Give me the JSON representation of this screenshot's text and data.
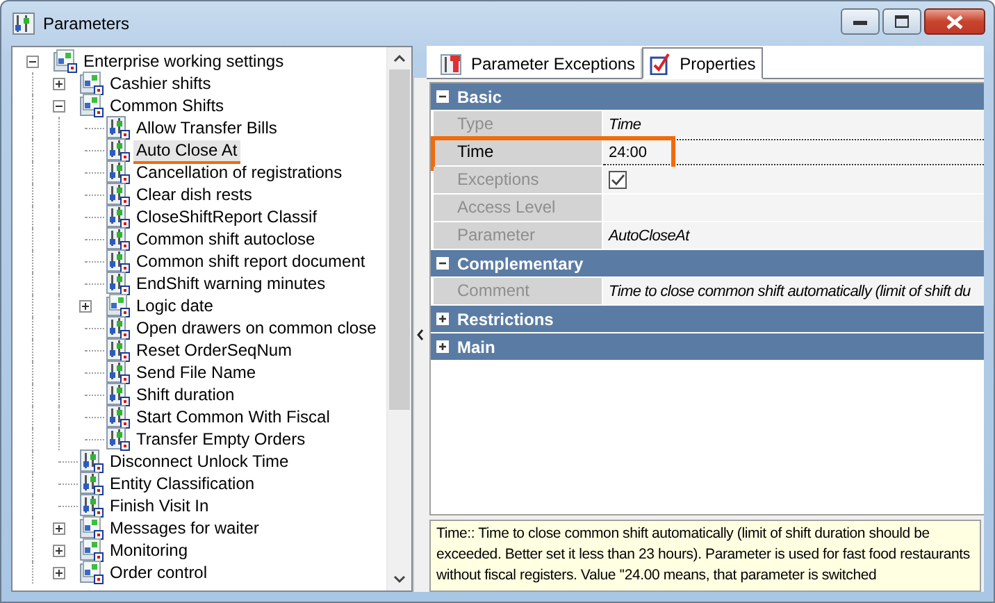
{
  "window": {
    "title": "Parameters"
  },
  "tree": [
    {
      "label": "Enterprise working settings",
      "kind": "group",
      "expanded": true,
      "selected": false,
      "annotated": false,
      "children": [
        {
          "label": "Cashier shifts",
          "kind": "group",
          "expanded": false,
          "selected": false,
          "annotated": false
        },
        {
          "label": "Common Shifts",
          "kind": "group",
          "expanded": true,
          "selected": false,
          "annotated": false,
          "children": [
            {
              "label": "Allow Transfer Bills",
              "kind": "param",
              "selected": false,
              "annotated": false
            },
            {
              "label": "Auto Close At",
              "kind": "param",
              "selected": true,
              "annotated": true
            },
            {
              "label": "Cancellation of registrations",
              "kind": "param",
              "selected": false,
              "annotated": false
            },
            {
              "label": "Clear dish rests",
              "kind": "param",
              "selected": false,
              "annotated": false
            },
            {
              "label": "CloseShiftReport Classif",
              "kind": "param",
              "selected": false,
              "annotated": false
            },
            {
              "label": "Common shift autoclose",
              "kind": "param",
              "selected": false,
              "annotated": false
            },
            {
              "label": "Common shift report document",
              "kind": "param",
              "selected": false,
              "annotated": false
            },
            {
              "label": "EndShift warning minutes",
              "kind": "param",
              "selected": false,
              "annotated": false
            },
            {
              "label": "Logic date",
              "kind": "group",
              "expanded": false,
              "selected": false,
              "annotated": false
            },
            {
              "label": "Open drawers on common close",
              "kind": "param",
              "selected": false,
              "annotated": false
            },
            {
              "label": "Reset OrderSeqNum",
              "kind": "param",
              "selected": false,
              "annotated": false
            },
            {
              "label": "Send File Name",
              "kind": "param",
              "selected": false,
              "annotated": false
            },
            {
              "label": "Shift duration",
              "kind": "param",
              "selected": false,
              "annotated": false
            },
            {
              "label": "Start Common With Fiscal",
              "kind": "param",
              "selected": false,
              "annotated": false
            },
            {
              "label": "Transfer Empty Orders",
              "kind": "param",
              "selected": false,
              "annotated": false
            }
          ]
        },
        {
          "label": "Disconnect Unlock Time",
          "kind": "param",
          "selected": false,
          "annotated": false
        },
        {
          "label": "Entity Classification",
          "kind": "param",
          "selected": false,
          "annotated": false
        },
        {
          "label": "Finish Visit In",
          "kind": "param",
          "selected": false,
          "annotated": false
        },
        {
          "label": "Messages for waiter",
          "kind": "group",
          "expanded": false,
          "selected": false,
          "annotated": false
        },
        {
          "label": "Monitoring",
          "kind": "group",
          "expanded": false,
          "selected": false,
          "annotated": false
        },
        {
          "label": "Order control",
          "kind": "group",
          "expanded": false,
          "selected": false,
          "annotated": false
        }
      ]
    }
  ],
  "tabs": [
    {
      "label": "Parameter Exceptions",
      "kind": "exceptions",
      "selected": false
    },
    {
      "label": "Properties",
      "kind": "properties",
      "selected": true
    }
  ],
  "grid": [
    {
      "name": "Basic",
      "expanded": true,
      "rows": [
        {
          "label": "Type",
          "kind": "text",
          "value": "Time",
          "readonly": true,
          "annotated": false
        },
        {
          "label": "Time",
          "kind": "text",
          "value": "24:00",
          "readonly": false,
          "annotated": true
        },
        {
          "label": "Exceptions",
          "kind": "checkbox",
          "checked": true,
          "readonly": true,
          "annotated": false
        },
        {
          "label": "Access Level",
          "kind": "text",
          "readonly": true,
          "annotated": false
        },
        {
          "label": "Parameter",
          "kind": "text",
          "value": "AutoCloseAt",
          "readonly": true,
          "annotated": false
        }
      ]
    },
    {
      "name": "Complementary",
      "expanded": true,
      "rows": [
        {
          "label": "Comment",
          "kind": "text",
          "value": "Time to close common shift automatically (limit of shift du",
          "readonly": true,
          "annotated": false
        }
      ]
    },
    {
      "name": "Restrictions",
      "expanded": false
    },
    {
      "name": "Main",
      "expanded": false
    }
  ],
  "description": "Time:: Time to close common shift automatically (limit of shift duration should be exceeded. Better set it less than 23 hours). Parameter is used for fast food restaurants without fiscal registers. Value ''24.00 means, that parameter is switched"
}
